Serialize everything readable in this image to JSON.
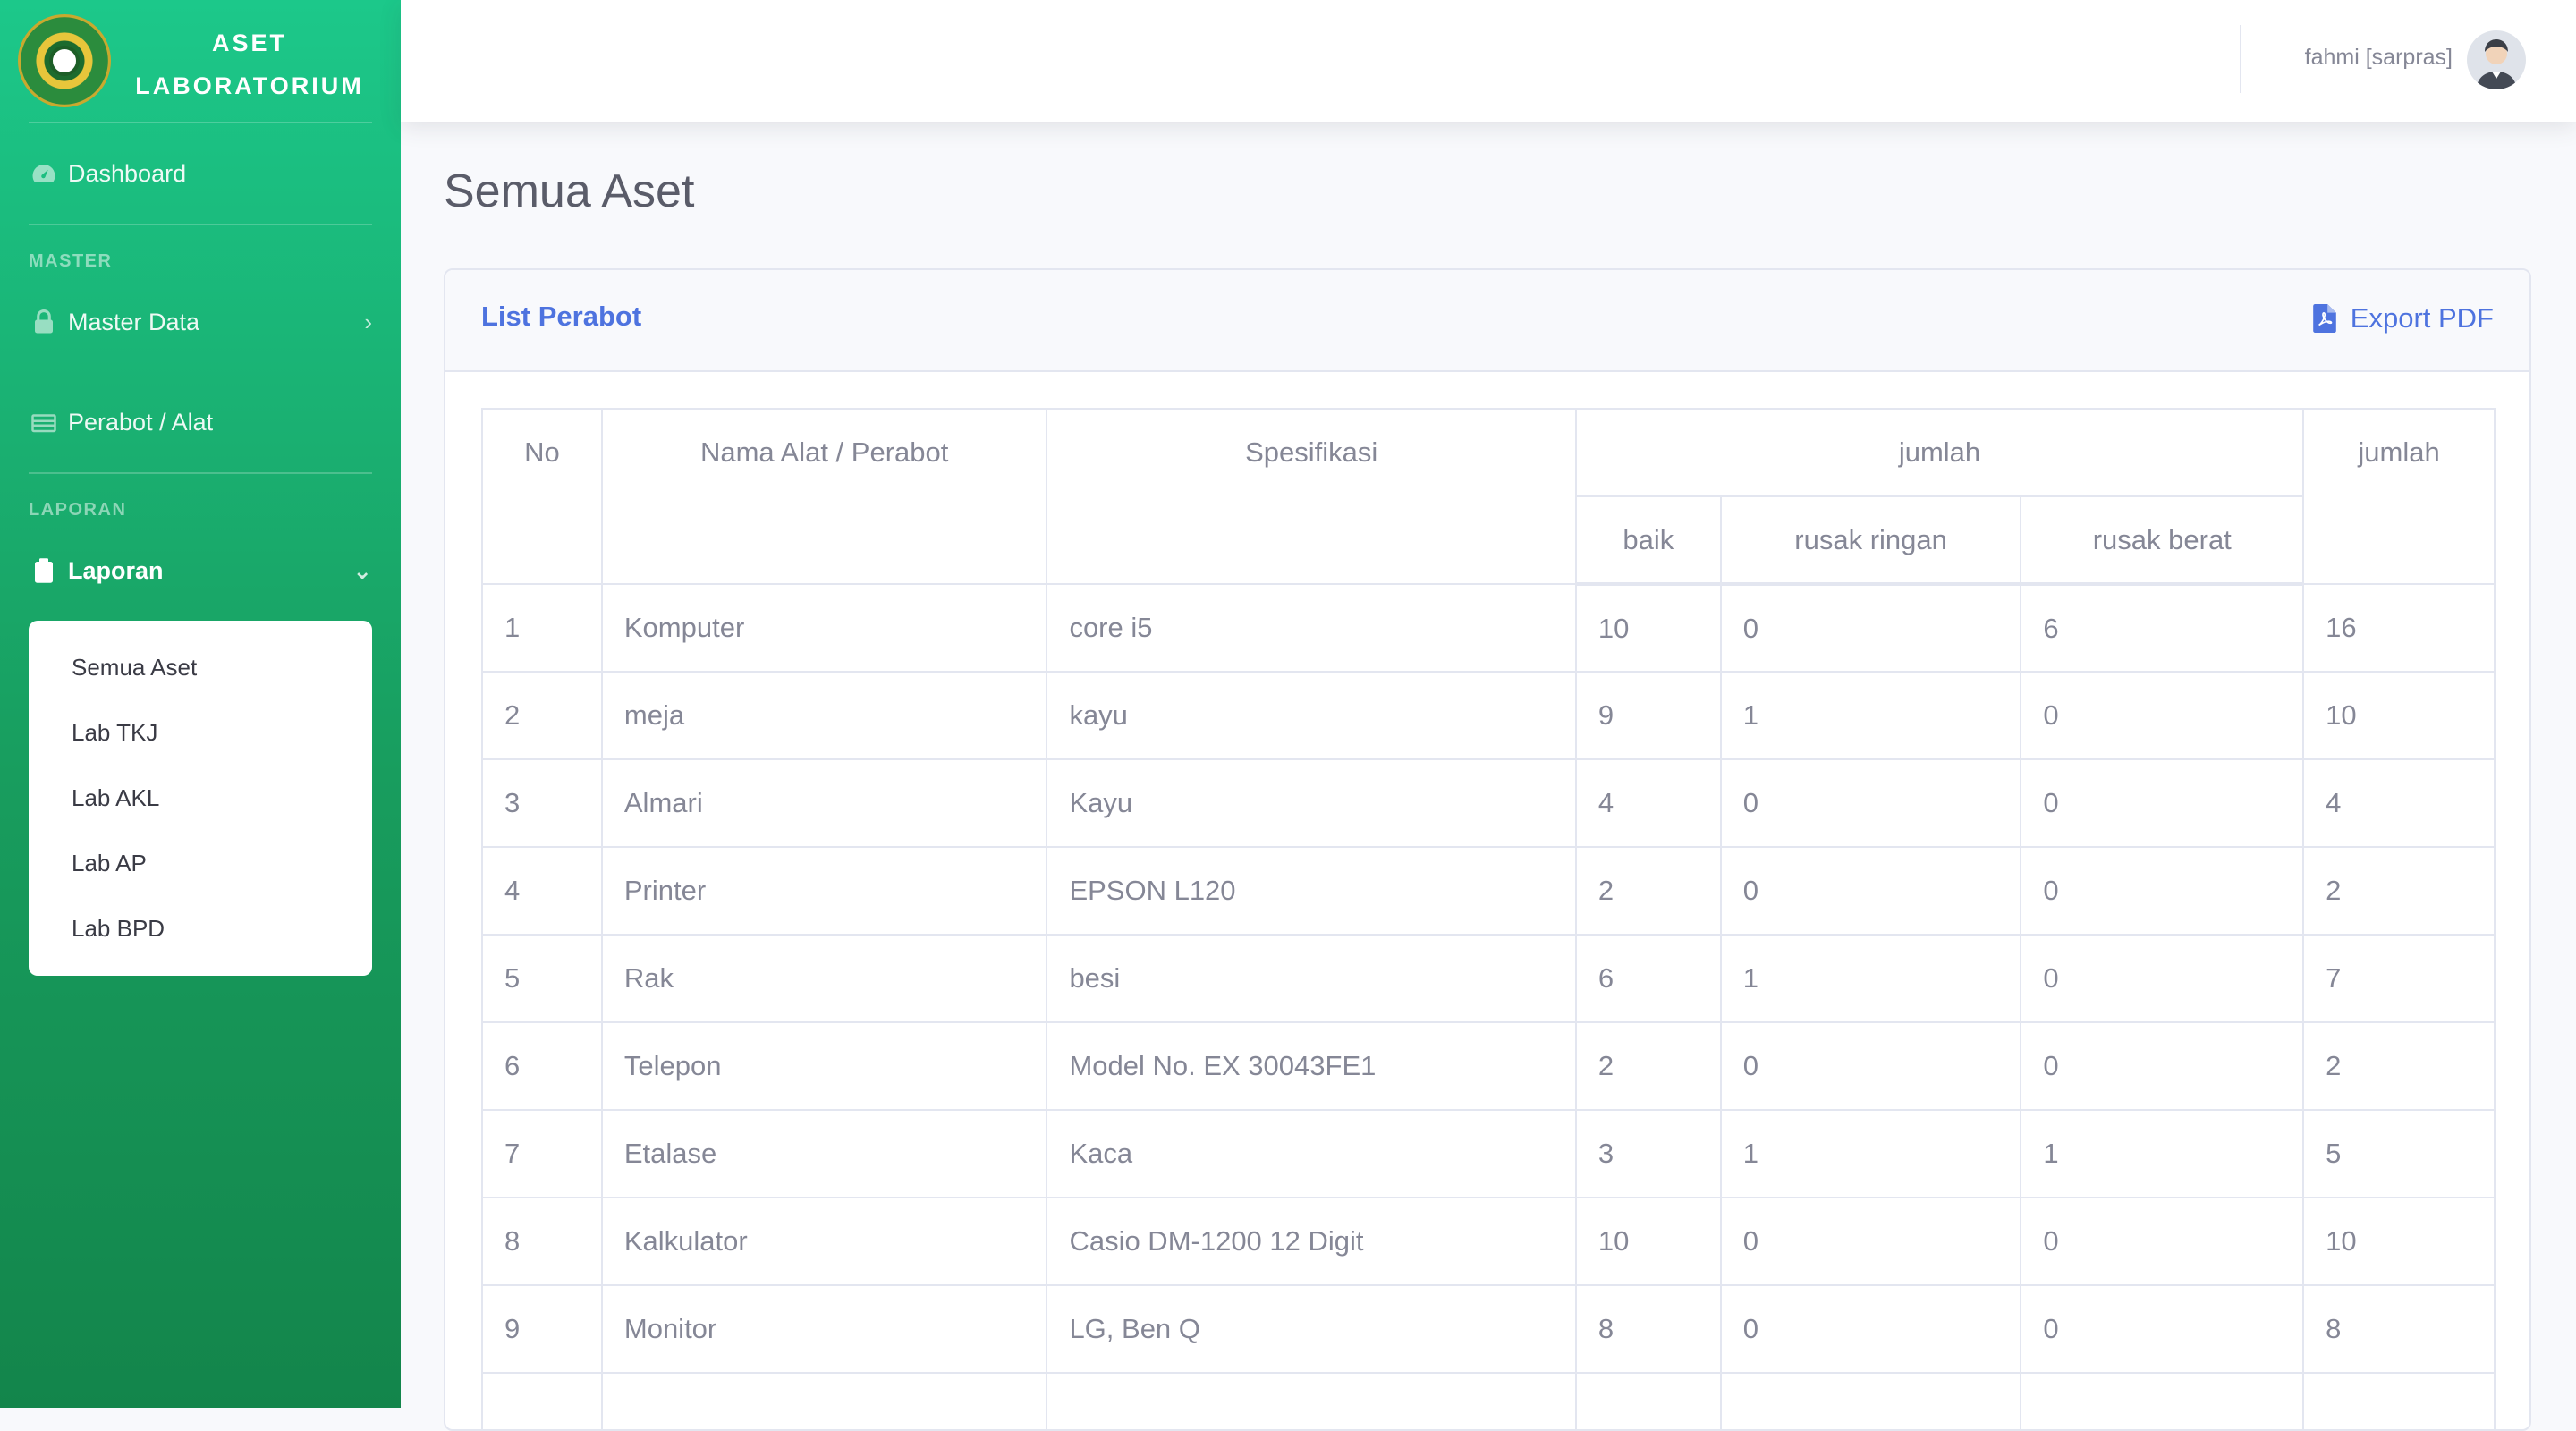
{
  "brand": {
    "line1": "ASET",
    "line2": "LABORATORIUM"
  },
  "sidebar": {
    "dashboard": "Dashboard",
    "section_master": "MASTER",
    "master_data": "Master Data",
    "perabot": "Perabot / Alat",
    "section_laporan": "LAPORAN",
    "laporan": "Laporan",
    "submenu": [
      "Semua Aset",
      "Lab TKJ",
      "Lab AKL",
      "Lab AP",
      "Lab BPD"
    ]
  },
  "topbar": {
    "user": "fahmi [sarpras]"
  },
  "page": {
    "title": "Semua Aset"
  },
  "card": {
    "title": "List Perabot",
    "export_label": "Export PDF"
  },
  "table": {
    "headers": {
      "no": "No",
      "nama": "Nama Alat / Perabot",
      "spesifikasi": "Spesifikasi",
      "jumlah_group": "jumlah",
      "baik": "baik",
      "rusak_ringan": "rusak ringan",
      "rusak_berat": "rusak berat",
      "jumlah": "jumlah"
    },
    "rows": [
      [
        "1",
        "Komputer",
        "core i5",
        "10",
        "0",
        "6",
        "16"
      ],
      [
        "2",
        "meja",
        "kayu",
        "9",
        "1",
        "0",
        "10"
      ],
      [
        "3",
        "Almari",
        "Kayu",
        "4",
        "0",
        "0",
        "4"
      ],
      [
        "4",
        "Printer",
        "EPSON L120",
        "2",
        "0",
        "0",
        "2"
      ],
      [
        "5",
        "Rak",
        "besi",
        "6",
        "1",
        "0",
        "7"
      ],
      [
        "6",
        "Telepon",
        "Model No. EX 30043FE1",
        "2",
        "0",
        "0",
        "2"
      ],
      [
        "7",
        "Etalase",
        "Kaca",
        "3",
        "1",
        "1",
        "5"
      ],
      [
        "8",
        "Kalkulator",
        "Casio DM-1200 12 Digit",
        "10",
        "0",
        "0",
        "10"
      ],
      [
        "9",
        "Monitor",
        "LG, Ben Q",
        "8",
        "0",
        "0",
        "8"
      ],
      [
        "",
        "",
        "",
        "",
        "",
        "",
        ""
      ]
    ]
  },
  "colors": {
    "sidebar_top": "#1cc88a",
    "sidebar_bottom": "#13854b",
    "accent": "#4e73df",
    "text_muted": "#858796"
  }
}
